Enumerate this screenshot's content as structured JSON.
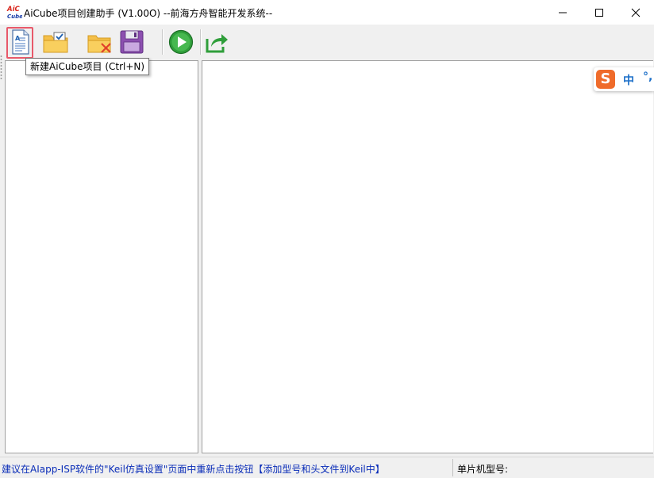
{
  "window": {
    "title": "AiCube项目创建助手 (V1.00O) --前海方舟智能开发系统--",
    "logo_text_top": "AiC",
    "logo_text_bottom": "Cube",
    "controls": {
      "minimize_icon": "minimize-icon",
      "maximize_icon": "maximize-icon",
      "close_icon": "close-icon"
    }
  },
  "toolbar": {
    "buttons": [
      {
        "name": "new-project",
        "icon": "new-document-icon"
      },
      {
        "name": "open-project",
        "icon": "folder-check-icon",
        "has_dropdown": true
      },
      {
        "name": "close-project",
        "icon": "folder-delete-icon"
      },
      {
        "name": "save-project",
        "icon": "floppy-disk-icon",
        "has_dropdown": true
      },
      {
        "name": "run",
        "icon": "play-icon"
      },
      {
        "name": "export",
        "icon": "share-arrow-icon"
      }
    ],
    "tooltip": "新建AiCube项目 (Ctrl+N)"
  },
  "ime": {
    "logo": "S",
    "mode": "中",
    "punct": "°,"
  },
  "status": {
    "message": "建议在AIapp-ISP软件的\"Keil仿真设置\"页面中重新点击按钮【添加型号和头文件到Keil中】",
    "chip_label": "单片机型号:"
  },
  "colors": {
    "accent_highlight": "#e8596a",
    "status_text": "#0a2db8",
    "ime_orange": "#ef6b2a",
    "ime_blue": "#1c6fc8"
  }
}
